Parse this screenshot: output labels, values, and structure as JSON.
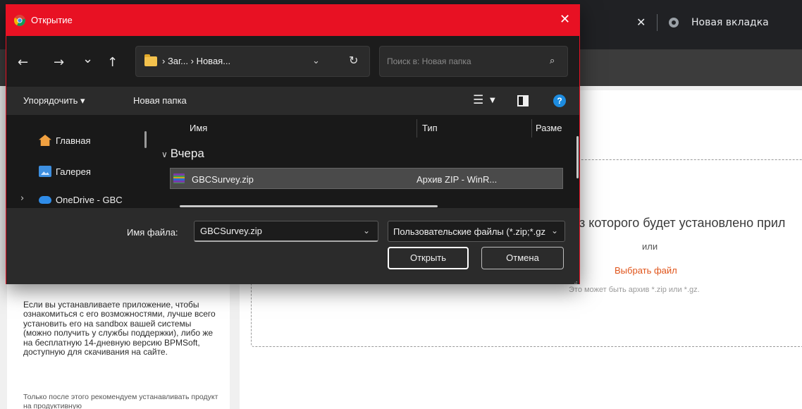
{
  "browser": {
    "tab_title": "Новая вкладка",
    "tab_close": "✕"
  },
  "background_page": {
    "upload_text": "з которого будет установлено прил",
    "or_text": "или",
    "choose_file": "Выбрать файл",
    "hint": "Это может быть архив *.zip или *.gz.",
    "sidebar_paragraph": "Если вы устанавливаете приложение, чтобы ознакомиться с его возможностями, лучше всего установить его на sandbox вашей системы (можно получить у службы поддержки), либо же на бесплатную 14-дневную версию BPMSoft, доступную для скачивания на сайте.",
    "sidebar_paragraph2": "Только после этого рекомендуем устанавливать продукт на продуктивную",
    "colors": {
      "accent_link": "#e0541a"
    }
  },
  "dialog": {
    "title": "Открытие",
    "close_icon": "✕",
    "nav": {
      "back": "←",
      "forward": "→",
      "recent": "⌄",
      "up": "↑",
      "refresh": "↻"
    },
    "address": "› Заг... › Новая...",
    "search_placeholder": "Поиск в: Новая папка",
    "commands": {
      "organize": "Упорядочить ▾",
      "new_folder": "Новая папка",
      "help": "?"
    },
    "sidebar": {
      "items": [
        {
          "label": "Главная",
          "icon": "home-icon"
        },
        {
          "label": "Галерея",
          "icon": "gallery-icon"
        },
        {
          "label": "OneDrive - GBC",
          "icon": "onedrive-icon"
        }
      ]
    },
    "columns": [
      "Имя",
      "Тип",
      "Разме"
    ],
    "group": "Вчера",
    "files": [
      {
        "name": "GBCSurvey.zip",
        "type": "Архив ZIP - WinR..."
      }
    ],
    "file_name_label": "Имя файла:",
    "file_name_value": "GBCSurvey.zip",
    "file_type": "Пользовательские файлы (*.zip;*.gz)",
    "open_button": "Открыть",
    "cancel_button": "Отмена",
    "colors": {
      "titlebar": "#e81123",
      "selection": "#4a4a4a"
    }
  }
}
